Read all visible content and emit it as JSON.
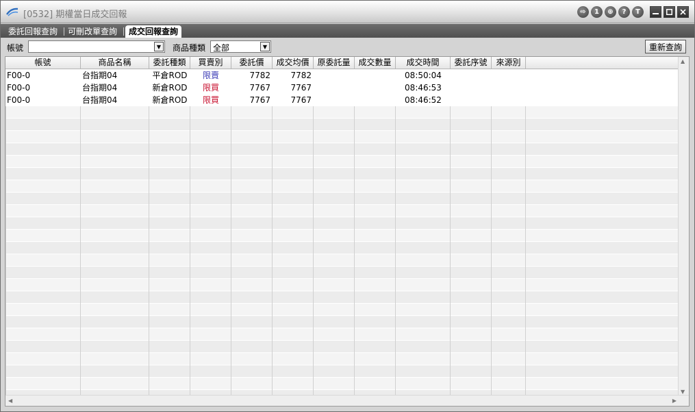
{
  "window": {
    "title": "[0532] 期權當日成交回報",
    "buttons": [
      "⇨",
      "1",
      "⊕",
      "?",
      "T"
    ]
  },
  "tabs": [
    {
      "label": "委託回報查詢",
      "active": false
    },
    {
      "label": "可刪改單查詢",
      "active": false
    },
    {
      "label": "成交回報查詢",
      "active": true
    }
  ],
  "filters": {
    "account_label": "帳號",
    "account_value": "",
    "product_type_label": "商品種類",
    "product_type_value": "全部",
    "refresh_label": "重新查詢"
  },
  "table": {
    "columns": [
      "帳號",
      "商品名稱",
      "委託種類",
      "買賣別",
      "委託價",
      "成交均價",
      "原委託量",
      "成交數量",
      "成交時間",
      "委託序號",
      "來源別"
    ],
    "rows": [
      {
        "account": "F00-0",
        "product": "台指期04",
        "order_type": "平倉ROD",
        "side": "限賣",
        "side_color": "#3a3ab5",
        "order_price": "7782",
        "avg_price": "7782",
        "orig_qty": "",
        "filled_qty": "",
        "time": "08:50:04",
        "order_no": "",
        "source": ""
      },
      {
        "account": "F00-0",
        "product": "台指期04",
        "order_type": "新倉ROD",
        "side": "限買",
        "side_color": "#c8102e",
        "order_price": "7767",
        "avg_price": "7767",
        "orig_qty": "",
        "filled_qty": "",
        "time": "08:46:53",
        "order_no": "",
        "source": ""
      },
      {
        "account": "F00-0",
        "product": "台指期04",
        "order_type": "新倉ROD",
        "side": "限買",
        "side_color": "#c8102e",
        "order_price": "7767",
        "avg_price": "7767",
        "orig_qty": "",
        "filled_qty": "",
        "time": "08:46:52",
        "order_no": "",
        "source": ""
      }
    ]
  },
  "colors": {
    "buy": "#c8102e",
    "sell": "#3a3ab5"
  }
}
